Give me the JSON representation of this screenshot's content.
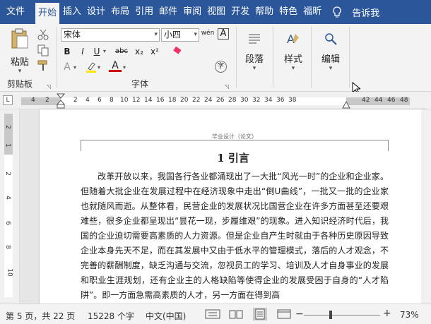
{
  "tabs": [
    "文件",
    "开始",
    "插入",
    "设计",
    "布局",
    "引用",
    "邮件",
    "审阅",
    "视图",
    "开发",
    "帮助",
    "特色",
    "福昕"
  ],
  "tell_me": "告诉我",
  "font": {
    "name": "宋体",
    "size": "小四",
    "wen": "wén",
    "A": "A",
    "bold": "B",
    "italic": "I",
    "underline": "U",
    "strike": "abc",
    "sub": "x₂",
    "sup": "x²",
    "color_A": "A",
    "circle": "字"
  },
  "clipboard": {
    "paste": "粘贴",
    "label": "剪贴板"
  },
  "groups": {
    "font_label": "字体",
    "paragraph": "段落",
    "styles": "样式",
    "editing": "编辑"
  },
  "ruler": {
    "corner": "L",
    "h": [
      "4",
      "2",
      "2",
      "4",
      "6",
      "8",
      "10",
      "12",
      "14",
      "16",
      "18",
      "20",
      "22",
      "24",
      "26",
      "28",
      "30",
      "32",
      "34",
      "36",
      "38",
      "42",
      "44",
      "46",
      "48"
    ],
    "v": [
      "2",
      "1",
      "2",
      "4",
      "6",
      "8",
      "10"
    ]
  },
  "doc": {
    "header": "毕业设计（论文）",
    "title": "1  引言",
    "body": "改革开放以来，我国各行各业都涌现出了一大批“风光一时”的企业和企业家。但随着大批企业在发展过程中在经济现象中走出“倒U曲线”，一批又一批的企业家也就随风而逝。从整体看，民营企业的发展状况比国营企业在许多方面甚至还要艰难些，很多企业都呈现出“昙花一现，步履维艰”的现象。进入知识经济时代后，我国的企业迫切需要高素质的人力资源。但是企业自产生时就由于各种历史原因导致企业本身先天不足，而在其发展中又由于低水平的管理模式，落后的人才观念，不完善的薪酬制度，缺乏沟通与交流，忽视员工的学习、培训及人才自身事业的发展和职业生涯规划，还有企业主的人格缺陷等使得企业的发展受困于自身的“人才陷阱”。即一方面急需高素质的人才，另一方面在得到高"
  },
  "status": {
    "page": "第 5 页，共 22 页",
    "words": "15228 个字",
    "lang": "中文(中国)",
    "zoom": "73%",
    "minus": "−",
    "plus": "+"
  },
  "zoom_value": 0.73
}
